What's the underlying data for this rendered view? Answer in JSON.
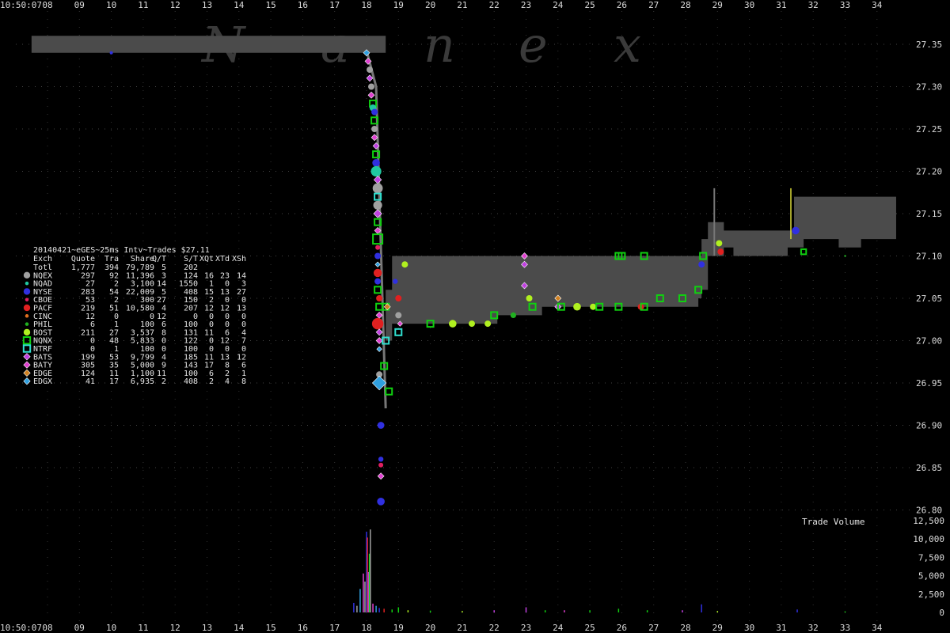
{
  "time_prefix": "10:50:07",
  "watermark": [
    "N",
    "a",
    "n",
    "e",
    "x"
  ],
  "chart_data": {
    "type": "scatter",
    "x_axis": {
      "minute_prefix": "10:50:",
      "ticks": [
        "08",
        "09",
        "10",
        "11",
        "12",
        "13",
        "14",
        "15",
        "16",
        "17",
        "18",
        "19",
        "20",
        "21",
        "22",
        "23",
        "24",
        "25",
        "26",
        "27",
        "28",
        "29",
        "30",
        "31",
        "32",
        "33",
        "34"
      ],
      "range": [
        7.5,
        34.9
      ]
    },
    "y_axis": {
      "ticks": [
        "27.35",
        "27.30",
        "27.25",
        "27.20",
        "27.15",
        "27.10",
        "27.05",
        "27.00",
        "26.95",
        "26.90",
        "26.85",
        "26.80"
      ],
      "range": [
        26.79,
        27.375
      ]
    },
    "volume_axis": {
      "label": "Trade Volume",
      "ticks": [
        "12,500",
        "10,000",
        "7,500",
        "5,000",
        "2,500",
        "0"
      ],
      "range": [
        0,
        13000
      ]
    },
    "legend": {
      "title": "20140421~eGES~25ms Intv~Trades $27.11",
      "header": [
        "Exch",
        "Quote",
        "Tra",
        "Share",
        "Q/T",
        "S/T",
        "XQt",
        "XTd",
        "XSh"
      ],
      "total": [
        "Totl",
        "1,777",
        "394",
        "79,789",
        "5",
        "202",
        "",
        "",
        ""
      ],
      "rows": [
        {
          "exch": "NQEX",
          "marker": "circle",
          "color": "#a0a0a0",
          "vals": [
            "297",
            "92",
            "11,396",
            "3",
            "124",
            "16",
            "23",
            "14"
          ]
        },
        {
          "exch": "NQAD",
          "marker": "dot",
          "color": "#20c8a0",
          "vals": [
            "27",
            "2",
            "3,100",
            "14",
            "1550",
            "1",
            "0",
            "3"
          ]
        },
        {
          "exch": "NYSE",
          "marker": "circle",
          "color": "#3030e0",
          "vals": [
            "283",
            "54",
            "22,009",
            "5",
            "408",
            "15",
            "13",
            "27"
          ]
        },
        {
          "exch": "CBOE",
          "marker": "dot",
          "color": "#e02060",
          "vals": [
            "53",
            "2",
            "300",
            "27",
            "150",
            "2",
            "0",
            "0"
          ]
        },
        {
          "exch": "PACF",
          "marker": "circle",
          "color": "#e02020",
          "vals": [
            "219",
            "51",
            "10,580",
            "4",
            "207",
            "12",
            "12",
            "13"
          ]
        },
        {
          "exch": "CINC",
          "marker": "dot",
          "color": "#e07020",
          "vals": [
            "12",
            "0",
            "0",
            "12",
            "0",
            "0",
            "0",
            "0"
          ]
        },
        {
          "exch": "PHIL",
          "marker": "dot",
          "color": "#20b020",
          "vals": [
            "6",
            "1",
            "100",
            "6",
            "100",
            "0",
            "0",
            "0"
          ]
        },
        {
          "exch": "BOST",
          "marker": "circle",
          "color": "#b0f020",
          "vals": [
            "211",
            "27",
            "3,537",
            "8",
            "131",
            "11",
            "6",
            "4"
          ]
        },
        {
          "exch": "NQNX",
          "marker": "square",
          "color": "#10d010",
          "vals": [
            "0",
            "48",
            "5,833",
            "0",
            "122",
            "0",
            "12",
            "7"
          ]
        },
        {
          "exch": "NTRF",
          "marker": "square",
          "color": "#30e0d0",
          "vals": [
            "0",
            "1",
            "100",
            "0",
            "100",
            "0",
            "0",
            "0"
          ]
        },
        {
          "exch": "BATS",
          "marker": "diamond",
          "color": "#c040e0",
          "vals": [
            "199",
            "53",
            "9,799",
            "4",
            "185",
            "11",
            "13",
            "12"
          ]
        },
        {
          "exch": "BATY",
          "marker": "diamond",
          "color": "#e040d0",
          "vals": [
            "305",
            "35",
            "5,000",
            "9",
            "143",
            "17",
            "8",
            "6"
          ]
        },
        {
          "exch": "EDGE",
          "marker": "diamond",
          "color": "#d08020",
          "vals": [
            "124",
            "11",
            "1,100",
            "11",
            "100",
            "6",
            "2",
            "1"
          ]
        },
        {
          "exch": "EDGX",
          "marker": "diamond",
          "color": "#30a0e0",
          "vals": [
            "41",
            "17",
            "6,935",
            "2",
            "408",
            "2",
            "4",
            "8"
          ]
        }
      ]
    },
    "nbbo_spread": [
      [
        7.5,
        27.34,
        27.36
      ],
      [
        18.0,
        27.34,
        27.36
      ],
      [
        18.6,
        27.0,
        27.06
      ],
      [
        18.8,
        27.02,
        27.1
      ],
      [
        19.0,
        27.02,
        27.1
      ],
      [
        19.3,
        27.02,
        27.1
      ],
      [
        21.8,
        27.02,
        27.1
      ],
      [
        22.1,
        27.03,
        27.1
      ],
      [
        23.0,
        27.03,
        27.1
      ],
      [
        23.5,
        27.04,
        27.1
      ],
      [
        28.4,
        27.05,
        27.1
      ],
      [
        28.5,
        27.06,
        27.12
      ],
      [
        28.7,
        27.1,
        27.14
      ],
      [
        29.0,
        27.1,
        27.14
      ],
      [
        29.2,
        27.11,
        27.13
      ],
      [
        29.5,
        27.1,
        27.13
      ],
      [
        31.2,
        27.11,
        27.13
      ],
      [
        31.4,
        27.11,
        27.17
      ],
      [
        31.7,
        27.12,
        27.17
      ],
      [
        32.8,
        27.11,
        27.17
      ],
      [
        33.5,
        27.12,
        27.17
      ],
      [
        34.6,
        27.12,
        27.17
      ]
    ],
    "trades": [
      {
        "x": 10.0,
        "y": 27.34,
        "exch": "NYSE",
        "size": 0.5
      },
      {
        "x": 18.0,
        "y": 27.34,
        "exch": "EDGX",
        "size": 1
      },
      {
        "x": 18.05,
        "y": 27.33,
        "exch": "BATY",
        "size": 1
      },
      {
        "x": 18.1,
        "y": 27.32,
        "exch": "NQEX",
        "size": 1
      },
      {
        "x": 18.1,
        "y": 27.31,
        "exch": "BATS",
        "size": 1
      },
      {
        "x": 18.15,
        "y": 27.3,
        "exch": "NQEX",
        "size": 1
      },
      {
        "x": 18.15,
        "y": 27.29,
        "exch": "BATY",
        "size": 1
      },
      {
        "x": 18.2,
        "y": 27.28,
        "exch": "NQNX",
        "size": 1
      },
      {
        "x": 18.2,
        "y": 27.275,
        "exch": "NQAD",
        "size": 1.4
      },
      {
        "x": 18.25,
        "y": 27.27,
        "exch": "NYSE",
        "size": 1
      },
      {
        "x": 18.25,
        "y": 27.26,
        "exch": "NQNX",
        "size": 1
      },
      {
        "x": 18.25,
        "y": 27.25,
        "exch": "NQEX",
        "size": 1
      },
      {
        "x": 18.25,
        "y": 27.24,
        "exch": "BATY",
        "size": 1
      },
      {
        "x": 18.3,
        "y": 27.23,
        "exch": "BATS",
        "size": 1
      },
      {
        "x": 18.3,
        "y": 27.22,
        "exch": "NQNX",
        "size": 1
      },
      {
        "x": 18.3,
        "y": 27.21,
        "exch": "NYSE",
        "size": 1.2
      },
      {
        "x": 18.3,
        "y": 27.2,
        "exch": "NQAD",
        "size": 2.2
      },
      {
        "x": 18.35,
        "y": 27.19,
        "exch": "BATS",
        "size": 1.2
      },
      {
        "x": 18.35,
        "y": 27.18,
        "exch": "NQEX",
        "size": 1.6
      },
      {
        "x": 18.35,
        "y": 27.17,
        "exch": "NTRF",
        "size": 1
      },
      {
        "x": 18.35,
        "y": 27.16,
        "exch": "NQEX",
        "size": 1.4
      },
      {
        "x": 18.35,
        "y": 27.15,
        "exch": "BATS",
        "size": 1.3
      },
      {
        "x": 18.35,
        "y": 27.14,
        "exch": "NQNX",
        "size": 1
      },
      {
        "x": 18.35,
        "y": 27.13,
        "exch": "BATY",
        "size": 1
      },
      {
        "x": 18.35,
        "y": 27.12,
        "exch": "NQNX",
        "size": 1.5
      },
      {
        "x": 18.35,
        "y": 27.11,
        "exch": "CBOE",
        "size": 1
      },
      {
        "x": 18.35,
        "y": 27.1,
        "exch": "NYSE",
        "size": 1
      },
      {
        "x": 18.35,
        "y": 27.09,
        "exch": "EDGX",
        "size": 0.8
      },
      {
        "x": 18.35,
        "y": 27.08,
        "exch": "PACF",
        "size": 1.3
      },
      {
        "x": 18.35,
        "y": 27.07,
        "exch": "NYSE",
        "size": 1
      },
      {
        "x": 18.35,
        "y": 27.06,
        "exch": "NQNX",
        "size": 1
      },
      {
        "x": 18.4,
        "y": 27.05,
        "exch": "PACF",
        "size": 1
      },
      {
        "x": 18.4,
        "y": 27.04,
        "exch": "NQNX",
        "size": 1
      },
      {
        "x": 18.4,
        "y": 27.03,
        "exch": "BATY",
        "size": 1
      },
      {
        "x": 18.35,
        "y": 27.02,
        "exch": "PACF",
        "size": 1.8
      },
      {
        "x": 18.4,
        "y": 27.01,
        "exch": "BATS",
        "size": 1
      },
      {
        "x": 18.4,
        "y": 27.0,
        "exch": "BATY",
        "size": 1
      },
      {
        "x": 18.4,
        "y": 26.99,
        "exch": "EDGX",
        "size": 0.8
      },
      {
        "x": 18.4,
        "y": 26.96,
        "exch": "NQEX",
        "size": 1
      },
      {
        "x": 18.4,
        "y": 26.95,
        "exch": "EDGX",
        "size": 2.2
      },
      {
        "x": 18.45,
        "y": 26.9,
        "exch": "NYSE",
        "size": 1.1
      },
      {
        "x": 18.45,
        "y": 26.86,
        "exch": "NYSE",
        "size": 0.8
      },
      {
        "x": 18.45,
        "y": 26.853,
        "exch": "CBOE",
        "size": 1
      },
      {
        "x": 18.45,
        "y": 26.84,
        "exch": "BATY",
        "size": 1
      },
      {
        "x": 18.45,
        "y": 26.81,
        "exch": "NYSE",
        "size": 1.2
      },
      {
        "x": 18.6,
        "y": 27.04,
        "exch": "NQNX",
        "size": 1
      },
      {
        "x": 18.65,
        "y": 27.04,
        "exch": "EDGE",
        "size": 1
      },
      {
        "x": 18.7,
        "y": 26.94,
        "exch": "NQNX",
        "size": 1
      },
      {
        "x": 18.6,
        "y": 27.0,
        "exch": "NTRF",
        "size": 1
      },
      {
        "x": 18.55,
        "y": 26.97,
        "exch": "NQNX",
        "size": 1
      },
      {
        "x": 18.9,
        "y": 27.07,
        "exch": "NYSE",
        "size": 0.8
      },
      {
        "x": 19.0,
        "y": 27.05,
        "exch": "PACF",
        "size": 1
      },
      {
        "x": 19.0,
        "y": 27.03,
        "exch": "NQEX",
        "size": 1
      },
      {
        "x": 19.0,
        "y": 27.01,
        "exch": "NTRF",
        "size": 1
      },
      {
        "x": 19.05,
        "y": 27.02,
        "exch": "BATY",
        "size": 0.8
      },
      {
        "x": 19.2,
        "y": 27.09,
        "exch": "BOST",
        "size": 1
      },
      {
        "x": 20.0,
        "y": 27.02,
        "exch": "NQNX",
        "size": 1
      },
      {
        "x": 20.7,
        "y": 27.02,
        "exch": "BOST",
        "size": 1.2
      },
      {
        "x": 21.3,
        "y": 27.02,
        "exch": "BOST",
        "size": 1
      },
      {
        "x": 21.8,
        "y": 27.02,
        "exch": "BOST",
        "size": 1
      },
      {
        "x": 22.0,
        "y": 27.03,
        "exch": "NQNX",
        "size": 1
      },
      {
        "x": 22.6,
        "y": 27.03,
        "exch": "PHIL",
        "size": 1.2
      },
      {
        "x": 22.95,
        "y": 27.09,
        "exch": "BATS",
        "size": 1
      },
      {
        "x": 22.95,
        "y": 27.1,
        "exch": "BATY",
        "size": 1
      },
      {
        "x": 22.95,
        "y": 27.065,
        "exch": "BATS",
        "size": 1
      },
      {
        "x": 23.1,
        "y": 27.05,
        "exch": "BOST",
        "size": 1
      },
      {
        "x": 23.2,
        "y": 27.04,
        "exch": "NQNX",
        "size": 1
      },
      {
        "x": 24.0,
        "y": 27.05,
        "exch": "EDGE",
        "size": 1
      },
      {
        "x": 24.0,
        "y": 27.04,
        "exch": "BATS",
        "size": 1
      },
      {
        "x": 24.1,
        "y": 27.04,
        "exch": "NQNX",
        "size": 1
      },
      {
        "x": 24.6,
        "y": 27.04,
        "exch": "BOST",
        "size": 1.2
      },
      {
        "x": 25.1,
        "y": 27.04,
        "exch": "BOST",
        "size": 1
      },
      {
        "x": 25.3,
        "y": 27.04,
        "exch": "NQNX",
        "size": 1
      },
      {
        "x": 25.9,
        "y": 27.04,
        "exch": "NQNX",
        "size": 1
      },
      {
        "x": 25.9,
        "y": 27.1,
        "exch": "NQNX",
        "size": 1
      },
      {
        "x": 26.0,
        "y": 27.1,
        "exch": "NQNX",
        "size": 1
      },
      {
        "x": 26.6,
        "y": 27.04,
        "exch": "PACF",
        "size": 1
      },
      {
        "x": 26.7,
        "y": 27.04,
        "exch": "NQNX",
        "size": 1
      },
      {
        "x": 26.7,
        "y": 27.1,
        "exch": "NQNX",
        "size": 1
      },
      {
        "x": 27.2,
        "y": 27.05,
        "exch": "NQNX",
        "size": 1
      },
      {
        "x": 27.9,
        "y": 27.05,
        "exch": "NQNX",
        "size": 1
      },
      {
        "x": 28.4,
        "y": 27.06,
        "exch": "NQNX",
        "size": 1
      },
      {
        "x": 28.5,
        "y": 27.09,
        "exch": "NYSE",
        "size": 1
      },
      {
        "x": 28.55,
        "y": 27.1,
        "exch": "NQNX",
        "size": 1
      },
      {
        "x": 29.05,
        "y": 27.115,
        "exch": "BOST",
        "size": 1
      },
      {
        "x": 29.1,
        "y": 27.105,
        "exch": "PACF",
        "size": 1
      },
      {
        "x": 31.45,
        "y": 27.13,
        "exch": "NYSE",
        "size": 1.2
      },
      {
        "x": 31.7,
        "y": 27.105,
        "exch": "NQNX",
        "size": 0.8
      },
      {
        "x": 33.0,
        "y": 27.1,
        "exch": "PHIL",
        "size": 0.4
      }
    ],
    "volume_bars": [
      {
        "x": 17.6,
        "v": 1300,
        "c": "#3030e0"
      },
      {
        "x": 17.7,
        "v": 900,
        "c": "#a0a0a0"
      },
      {
        "x": 17.8,
        "v": 3200,
        "c": "#30a0e0"
      },
      {
        "x": 17.9,
        "v": 5300,
        "c": "#e040d0"
      },
      {
        "x": 17.95,
        "v": 4200,
        "c": "#a0a0a0"
      },
      {
        "x": 18.0,
        "v": 11000,
        "c": "#3030e0"
      },
      {
        "x": 18.03,
        "v": 10200,
        "c": "#e02020"
      },
      {
        "x": 18.06,
        "v": 5500,
        "c": "#c040e0"
      },
      {
        "x": 18.09,
        "v": 8000,
        "c": "#10d010"
      },
      {
        "x": 18.12,
        "v": 11300,
        "c": "#a0a0a0"
      },
      {
        "x": 18.2,
        "v": 1200,
        "c": "#e040d0"
      },
      {
        "x": 18.3,
        "v": 900,
        "c": "#30a0e0"
      },
      {
        "x": 18.4,
        "v": 600,
        "c": "#3030e0"
      },
      {
        "x": 18.55,
        "v": 500,
        "c": "#e02020"
      },
      {
        "x": 18.8,
        "v": 400,
        "c": "#10d010"
      },
      {
        "x": 19.0,
        "v": 700,
        "c": "#10d010"
      },
      {
        "x": 19.3,
        "v": 300,
        "c": "#b0f020"
      },
      {
        "x": 20.0,
        "v": 250,
        "c": "#10d010"
      },
      {
        "x": 21.0,
        "v": 200,
        "c": "#b0f020"
      },
      {
        "x": 22.0,
        "v": 300,
        "c": "#c040e0"
      },
      {
        "x": 23.0,
        "v": 700,
        "c": "#c040e0"
      },
      {
        "x": 23.6,
        "v": 300,
        "c": "#10d010"
      },
      {
        "x": 24.2,
        "v": 300,
        "c": "#e040d0"
      },
      {
        "x": 25.0,
        "v": 300,
        "c": "#10d010"
      },
      {
        "x": 25.9,
        "v": 500,
        "c": "#10d010"
      },
      {
        "x": 26.8,
        "v": 300,
        "c": "#10d010"
      },
      {
        "x": 27.9,
        "v": 300,
        "c": "#c040e0"
      },
      {
        "x": 28.5,
        "v": 1100,
        "c": "#3030e0"
      },
      {
        "x": 29.0,
        "v": 200,
        "c": "#b0f020"
      },
      {
        "x": 31.5,
        "v": 400,
        "c": "#3030e0"
      },
      {
        "x": 33.0,
        "v": 150,
        "c": "#10d010"
      }
    ]
  }
}
